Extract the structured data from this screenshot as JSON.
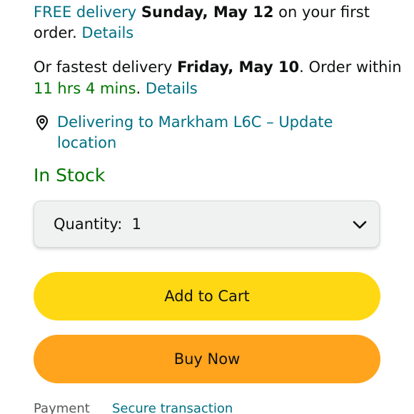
{
  "delivery": {
    "free_prefix": "FREE delivery",
    "free_date": "Sunday, May 12",
    "free_suffix": " on your first",
    "free_line2": "order. ",
    "free_details": "Details",
    "fast_prefix": "Or fastest delivery ",
    "fast_date": "Friday, May 10",
    "fast_suffix": ". Order within",
    "countdown": "11 hrs 4 mins",
    "period": ".",
    "fast_details": "Details"
  },
  "location": {
    "icon": "location-pin-icon",
    "line1": "Delivering to Markham L6C – Update",
    "line2": "location"
  },
  "stock_status": "In Stock",
  "quantity": {
    "label": "Quantity:",
    "value": "1",
    "icon": "chevron-down-icon"
  },
  "buttons": {
    "add_to_cart": "Add to Cart",
    "buy_now": "Buy Now"
  },
  "footer": {
    "payment_label": "Payment",
    "payment_value": "Secure transaction"
  },
  "colors": {
    "link": "#007185",
    "stock": "#007600",
    "add_to_cart": "#FFD814",
    "buy_now": "#FFA41C",
    "quantity_bg": "#F0F2F2"
  }
}
